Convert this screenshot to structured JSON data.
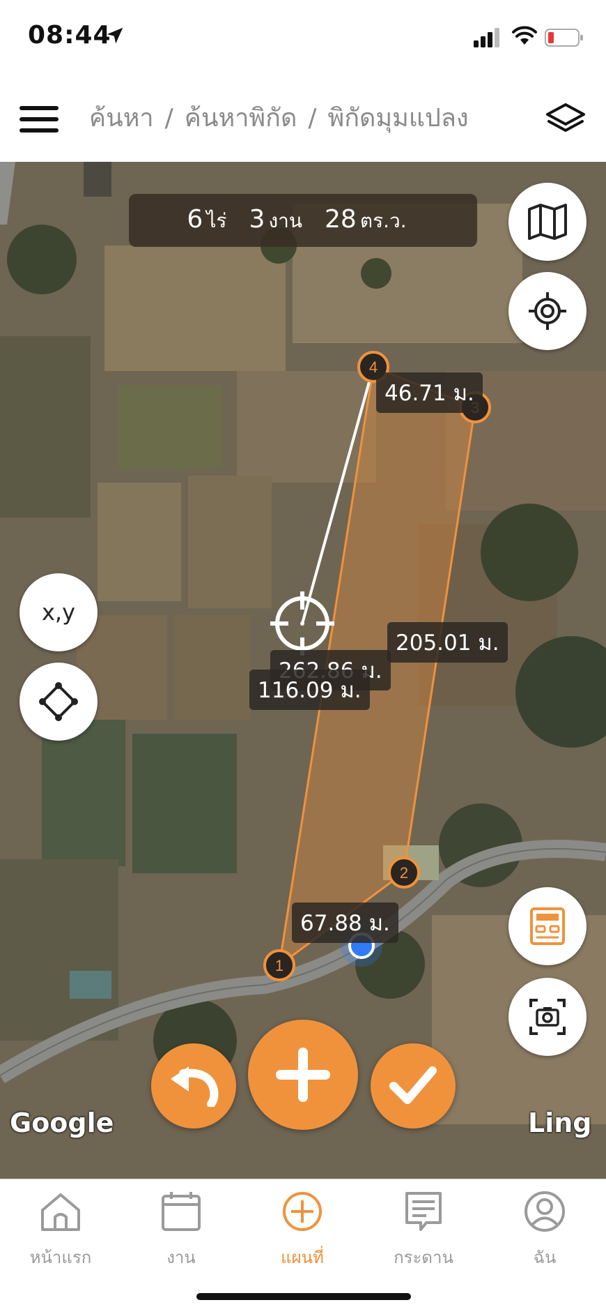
{
  "status_bar": {
    "time": "08:44",
    "icons": [
      "location-arrow-icon",
      "signal-icon",
      "wifi-icon",
      "battery-low-icon"
    ]
  },
  "header": {
    "menu_icon": "hamburger-icon",
    "breadcrumb": [
      "ค้นหา",
      "ค้นหาพิกัด",
      "พิกัดมุมแปลง"
    ],
    "separator": "/",
    "layers_icon": "layers-icon"
  },
  "map": {
    "area": {
      "rai": "6",
      "rai_unit": "ไร่",
      "ngan": "3",
      "ngan_unit": "งาน",
      "wa": "28",
      "wa_unit": "ตร.ว."
    },
    "buttons": {
      "map_type_icon": "map-icon",
      "locate_icon": "gps-target-icon",
      "xy_label": "x,y",
      "polygon_icon": "polygon-icon",
      "calculator_icon": "calculator-icon",
      "screenshot_icon": "camera-icon"
    },
    "points": [
      "1",
      "2",
      "3",
      "4"
    ],
    "distances": {
      "side_4_3": "46.71 ม.",
      "side_3_2": "205.01 ม.",
      "side_1_4": "262.86 ม.",
      "cursor_to_4": "116.09 ม.",
      "side_1_2": "67.88 ม."
    },
    "actions": {
      "undo_icon": "undo-icon",
      "add_icon": "plus-icon",
      "confirm_icon": "check-icon"
    },
    "attribution_left": "Google",
    "attribution_right": "Ling",
    "colors": {
      "accent": "#f0923c",
      "polygon_fill": "rgba(240,146,60,0.35)",
      "user_dot": "#2f7cf6"
    }
  },
  "bottom_nav": {
    "items": [
      {
        "label": "หน้าแรก",
        "icon": "home-icon",
        "active": false
      },
      {
        "label": "งาน",
        "icon": "calendar-icon",
        "active": false
      },
      {
        "label": "แผนที่",
        "icon": "plus-circle-icon",
        "active": true
      },
      {
        "label": "กระดาน",
        "icon": "board-icon",
        "active": false
      },
      {
        "label": "ฉัน",
        "icon": "user-icon",
        "active": false
      }
    ]
  }
}
